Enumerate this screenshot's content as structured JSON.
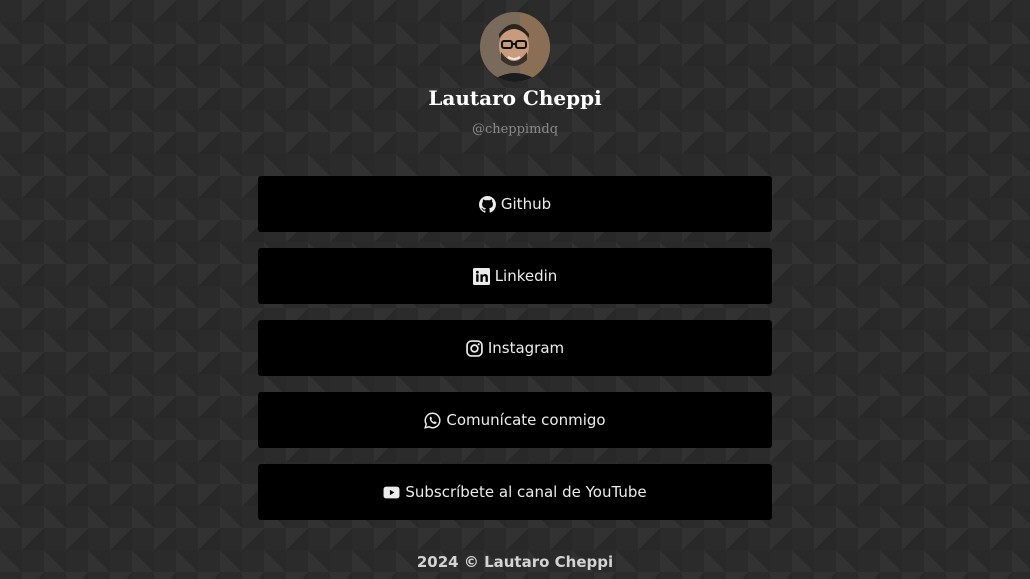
{
  "profile": {
    "name": "Lautaro Cheppi",
    "handle": "@cheppimdq"
  },
  "links": [
    {
      "label": "Github",
      "icon": "github-icon"
    },
    {
      "label": "Linkedin",
      "icon": "linkedin-icon"
    },
    {
      "label": "Instagram",
      "icon": "instagram-icon"
    },
    {
      "label": "Comunícate conmigo",
      "icon": "whatsapp-icon"
    },
    {
      "label": "Subscríbete al canal de YouTube",
      "icon": "youtube-icon"
    }
  ],
  "footer": {
    "text": "2024 © Lautaro Cheppi"
  },
  "colors": {
    "background": "#2b2b2b",
    "button": "#000000",
    "button_text": "#ececec",
    "handle": "#8a8a8a"
  }
}
